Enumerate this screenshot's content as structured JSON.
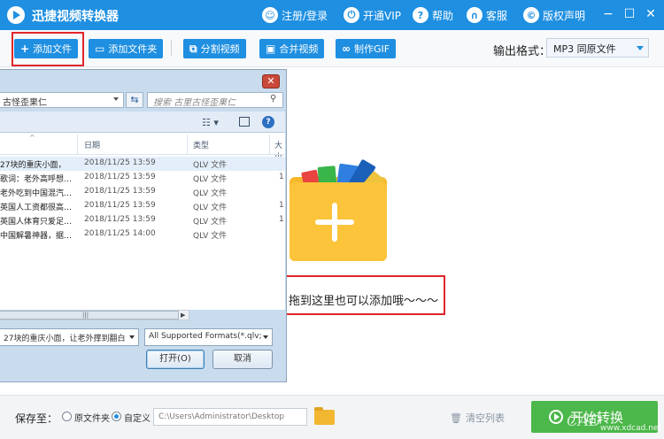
{
  "titlebar": {
    "title": "迅捷视频转换器",
    "links": [
      {
        "icon": "user-icon",
        "label": "注册/登录"
      },
      {
        "icon": "vip-icon",
        "label": "开通VIP"
      },
      {
        "icon": "help-icon",
        "label": "帮助"
      },
      {
        "icon": "headset-icon",
        "label": "客服"
      },
      {
        "icon": "copyright-icon",
        "label": "版权声明"
      }
    ]
  },
  "toolbar": {
    "add_file": "添加文件",
    "add_folder": "添加文件夹",
    "split_video": "分割视频",
    "merge_video": "合并视频",
    "make_gif": "制作GIF",
    "output_format_label": "输出格式：",
    "output_format_value": "MP3  同原文件"
  },
  "main": {
    "drop_hint": "拖到这里也可以添加哦～～～"
  },
  "dialog": {
    "address": "古怪歪果仁",
    "search_placeholder": "搜索 古里古怪歪果仁",
    "columns": {
      "date": "日期",
      "type": "类型",
      "size": "大小"
    },
    "files": [
      {
        "name": "27块的重庆小面，",
        "date": "2018/11/25 13:59",
        "type": "QLV 文件",
        "size": ""
      },
      {
        "name": "歌词：老外高呼想…",
        "date": "2018/11/25 13:59",
        "type": "QLV 文件",
        "size": "1"
      },
      {
        "name": "老外吃到中国混汽…",
        "date": "2018/11/25 13:59",
        "type": "QLV 文件",
        "size": ""
      },
      {
        "name": "英国人工资都很高…",
        "date": "2018/11/25 13:59",
        "type": "QLV 文件",
        "size": "1"
      },
      {
        "name": "英国人体育只爱足…",
        "date": "2018/11/25 13:59",
        "type": "QLV 文件",
        "size": "1"
      },
      {
        "name": "中国解暑神器，据…",
        "date": "2018/11/25 14:00",
        "type": "QLV 文件",
        "size": ""
      }
    ],
    "filename_value": "27块的重庆小面，让老外撑到翻白",
    "filter_value": "All Supported Formats(*.qlv;",
    "open_label": "打开(O)",
    "cancel_label": "取消"
  },
  "bottombar": {
    "save_to_label": "保存至：",
    "option_original": "原文件夹",
    "option_custom": "自定义",
    "path_value": "C:\\Users\\Administrator\\Desktop",
    "clear_list": "清空列表",
    "start_label": "开始转换",
    "watermark_text": "CAD",
    "watermark_url": "www.xdcad.net"
  },
  "colors": {
    "brand_blue": "#1e8fe1",
    "start_green": "#4cb74a",
    "highlight_red": "#e0262b",
    "folder_yellow": "#fbc43a"
  }
}
